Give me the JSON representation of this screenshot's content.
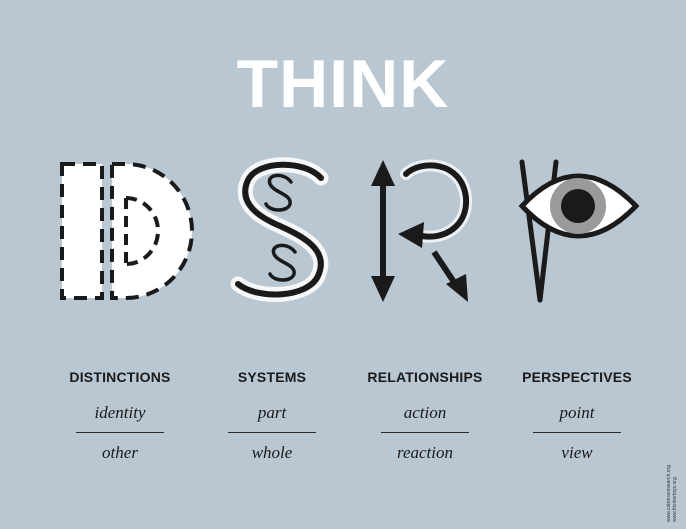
{
  "title": "THINK",
  "glyph_letters": [
    "D",
    "S",
    "R",
    "P"
  ],
  "columns": [
    {
      "heading": "DISTINCTIONS",
      "top": "identity",
      "bottom": "other"
    },
    {
      "heading": "SYSTEMS",
      "top": "part",
      "bottom": "whole"
    },
    {
      "heading": "RELATIONSHIPS",
      "top": "action",
      "bottom": "reaction"
    },
    {
      "heading": "PERSPECTIVES",
      "top": "point",
      "bottom": "view"
    }
  ],
  "credits": [
    "www.cabreraresearch.org",
    "www.thinkertoys.org"
  ],
  "colors": {
    "background": "#b9c7d3",
    "title": "#ffffff",
    "ink": "#1a1a1a",
    "iris": "#9a9a9a"
  }
}
